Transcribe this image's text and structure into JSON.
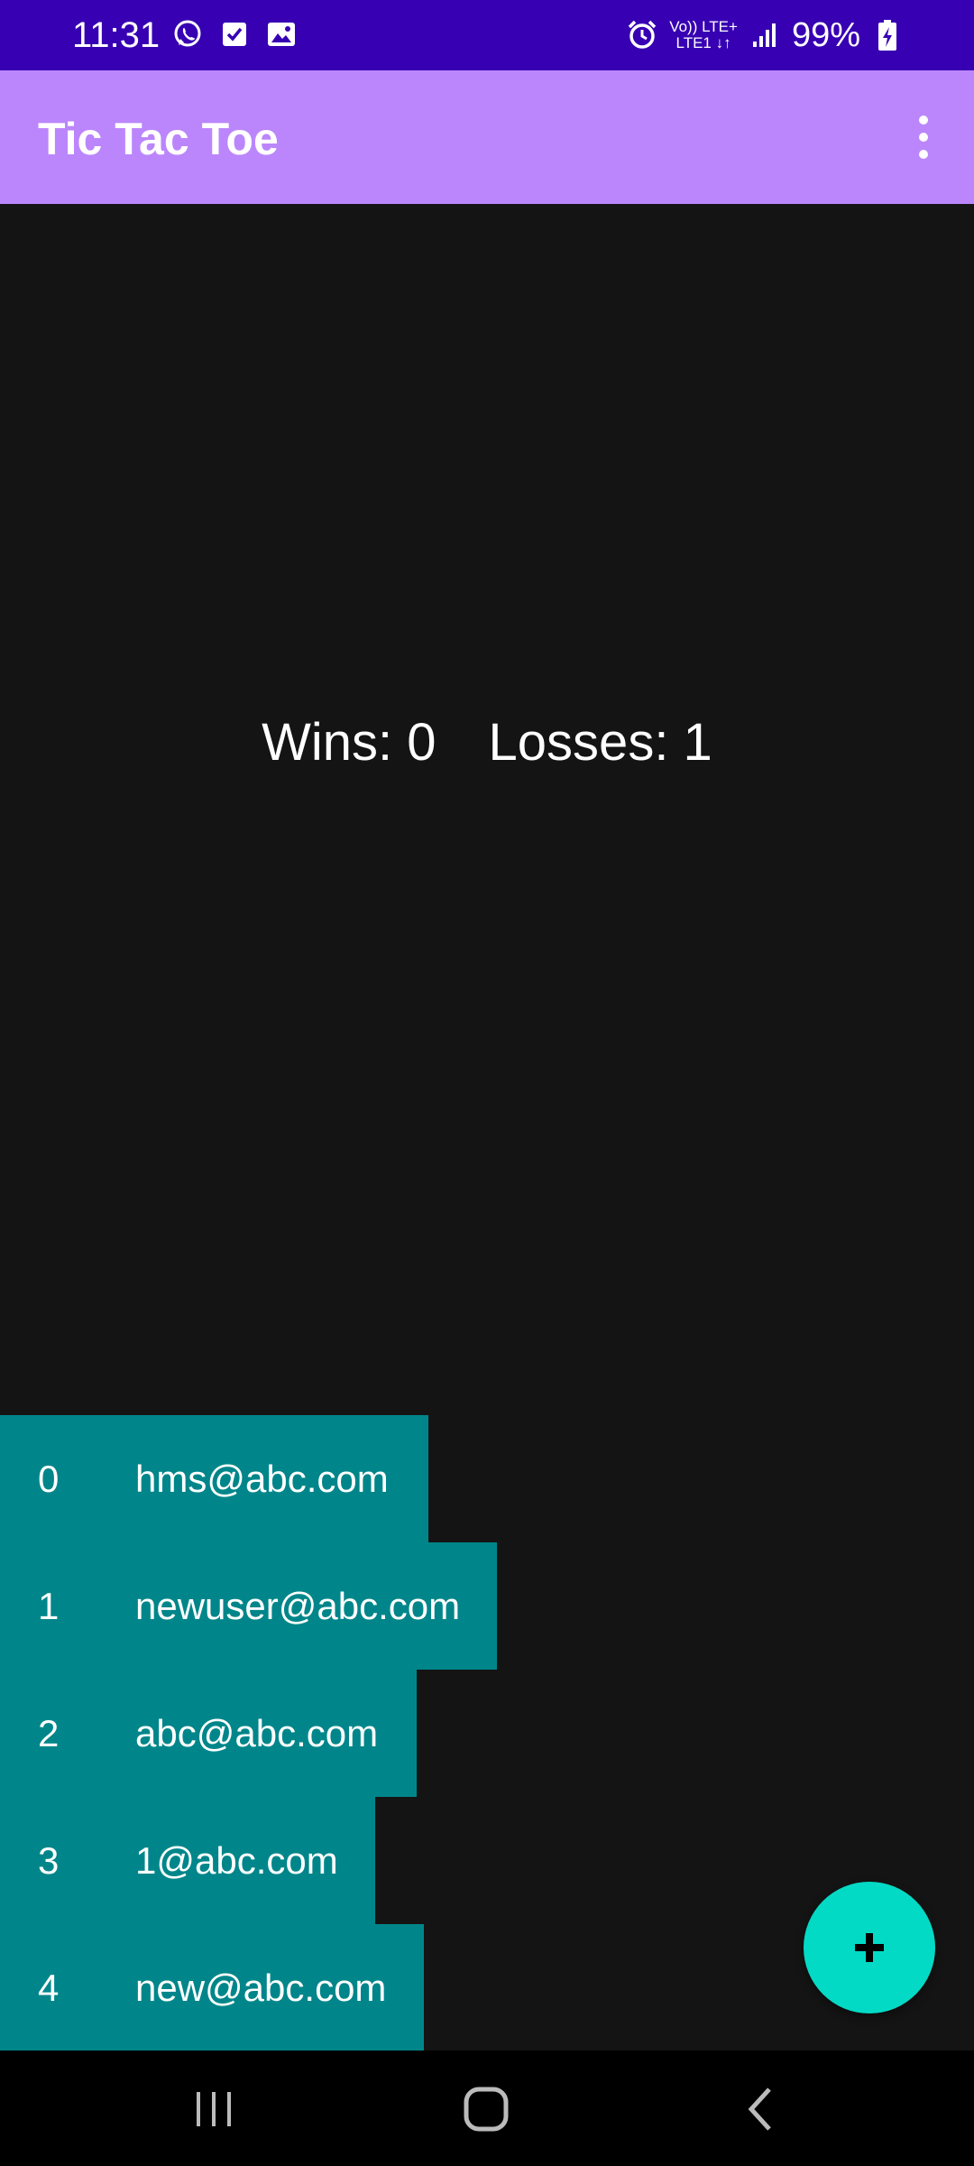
{
  "status_bar": {
    "time": "11:31",
    "left_icons": [
      "whatsapp-icon",
      "checkbox-notification-icon",
      "gallery-icon"
    ],
    "network_top": "Vo)) LTE+",
    "network_bottom": "LTE1 ↓↑",
    "battery": "99%",
    "background": "#3700b3"
  },
  "app_bar": {
    "title": "Tic Tac Toe",
    "background": "#bb86fc"
  },
  "score": {
    "wins": "Wins: 0",
    "losses": "Losses: 1"
  },
  "players": [
    {
      "index": "0",
      "email": "hms@abc.com"
    },
    {
      "index": "1",
      "email": "newuser@abc.com"
    },
    {
      "index": "2",
      "email": "abc@abc.com"
    },
    {
      "index": "3",
      "email": "1@abc.com"
    },
    {
      "index": "4",
      "email": "new@abc.com"
    }
  ],
  "fab": {
    "icon": "plus-icon",
    "color": "#03dac5"
  },
  "colors": {
    "list_item": "#00868a",
    "background": "#141414"
  }
}
